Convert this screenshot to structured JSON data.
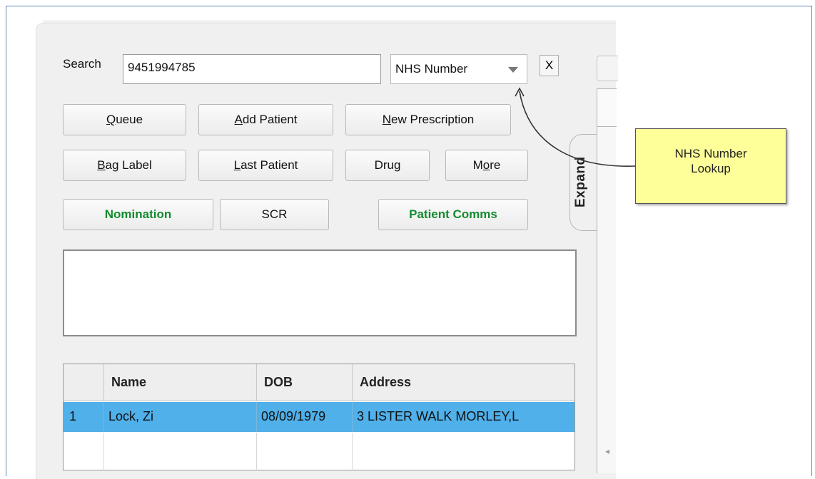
{
  "search": {
    "label": "Search",
    "value": "9451994785",
    "type_selected": "NHS Number",
    "clear_label": "X"
  },
  "buttons": {
    "queue": {
      "pre": "",
      "u": "Q",
      "post": "ueue"
    },
    "add_patient": {
      "pre": "",
      "u": "A",
      "post": "dd Patient"
    },
    "new_prescription": {
      "pre": "",
      "u": "N",
      "post": "ew Prescription"
    },
    "bag_label": {
      "pre": "",
      "u": "B",
      "post": "ag Label"
    },
    "last_patient": {
      "pre": "",
      "u": "L",
      "post": "ast Patient"
    },
    "drug": {
      "label": "Drug"
    },
    "more": {
      "pre": "M",
      "u": "o",
      "post": "re"
    },
    "nomination": {
      "label": "Nomination"
    },
    "scr": {
      "label": "SCR"
    },
    "patient_comms": {
      "label": "Patient Comms"
    }
  },
  "expand_tab": {
    "label": "Expand"
  },
  "table": {
    "columns": [
      "",
      "Name",
      "DOB",
      "Address"
    ],
    "rows": [
      {
        "num": "1",
        "name": "Lock, Zi",
        "dob": "08/09/1979",
        "address": "3 LISTER WALK MORLEY,L"
      }
    ]
  },
  "callout": {
    "line1": "NHS Number",
    "line2": "Lookup"
  },
  "colors": {
    "selected_row": "#4fb0ea",
    "green_text": "#138a2e",
    "callout_fill": "#ffff99",
    "frame_border": "#5b86b5"
  }
}
